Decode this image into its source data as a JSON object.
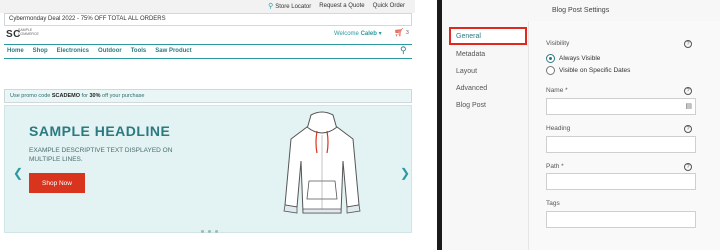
{
  "storefront": {
    "top_links": [
      "Store Locator",
      "Request a Quote",
      "Quick Order"
    ],
    "deal_text": "Cybermonday Deal 2022 - 75% OFF TOTAL ALL ORDERS",
    "logo": "SC",
    "logo_sub": "SAMPLE COMMERCE",
    "welcome_prefix": "Welcome",
    "welcome_name": "Caleb",
    "cart_count": "3",
    "nav": [
      "Home",
      "Shop",
      "Electronics",
      "Outdoor",
      "Tools",
      "Saw Product"
    ],
    "promo_prefix": "Use promo code",
    "promo_code": "SCADEMO",
    "promo_middle": "for",
    "promo_discount": "30%",
    "promo_suffix": "off your purchase",
    "headline": "SAMPLE HEADLINE",
    "description": "EXAMPLE DESCRIPTIVE TEXT DISPLAYED ON MULTIPLE LINES.",
    "cta": "Shop Now",
    "slides": 3
  },
  "settings": {
    "title": "Blog Post Settings",
    "nav": [
      "General",
      "Metadata",
      "Layout",
      "Advanced",
      "Blog Post"
    ],
    "active_nav": "General",
    "visibility_label": "Visibility",
    "visibility_options": [
      "Always Visible",
      "Visible on Specific Dates"
    ],
    "selected_visibility": "Always Visible",
    "name_label": "Name *",
    "heading_label": "Heading",
    "path_label": "Path *",
    "tags_label": "Tags",
    "help_glyph": "?"
  },
  "colors": {
    "accent_teal": "#2b7a80",
    "brand_red": "#d9341e",
    "highlight_red": "#e0281f"
  }
}
